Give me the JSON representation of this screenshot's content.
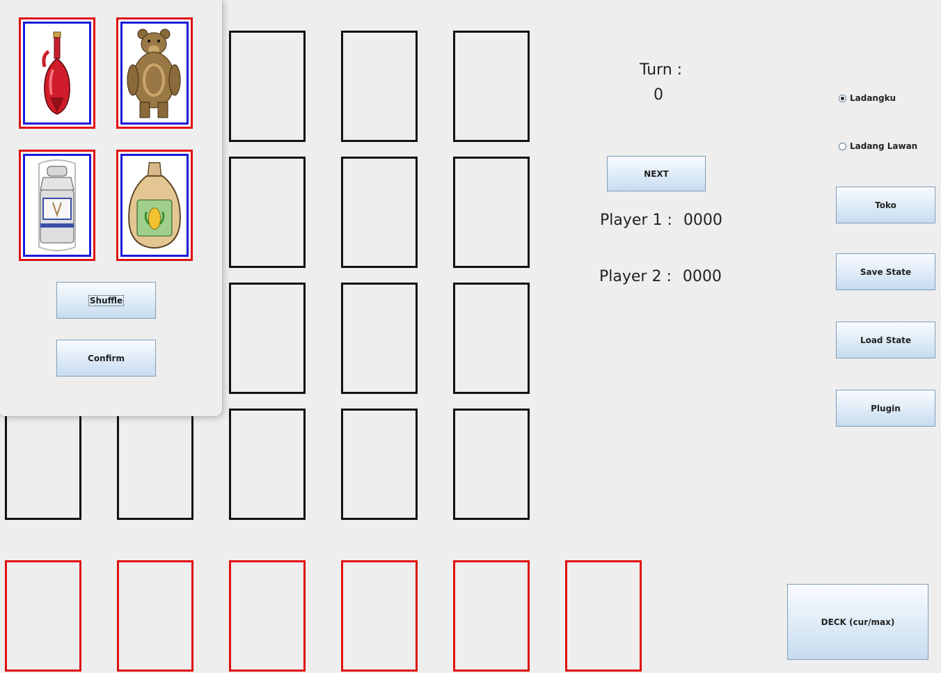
{
  "turn": {
    "label": "Turn :",
    "value": "0"
  },
  "next_button": "NEXT",
  "players": [
    {
      "label": "Player 1 :",
      "score": "0000"
    },
    {
      "label": "Player 2 :",
      "score": "0000"
    }
  ],
  "view_options": [
    {
      "label": "Ladangku",
      "selected": true
    },
    {
      "label": "Ladang Lawan",
      "selected": false
    }
  ],
  "side_buttons": {
    "toko": "Toko",
    "save_state": "Save State",
    "load_state": "Load State",
    "plugin": "Plugin"
  },
  "deck_button": "DECK (cur/max)",
  "shuffle_dialog": {
    "cards": [
      {
        "icon": "red-potion-icon"
      },
      {
        "icon": "bear-icon"
      },
      {
        "icon": "milk-can-icon"
      },
      {
        "icon": "corn-seed-bag-icon"
      }
    ],
    "shuffle_label": "Shuffle",
    "confirm_label": "Confirm"
  },
  "colors": {
    "field_border": "#111111",
    "hand_border": "#e01010",
    "card_inner_border": "#1a1ad8",
    "background": "#eeeeee"
  }
}
